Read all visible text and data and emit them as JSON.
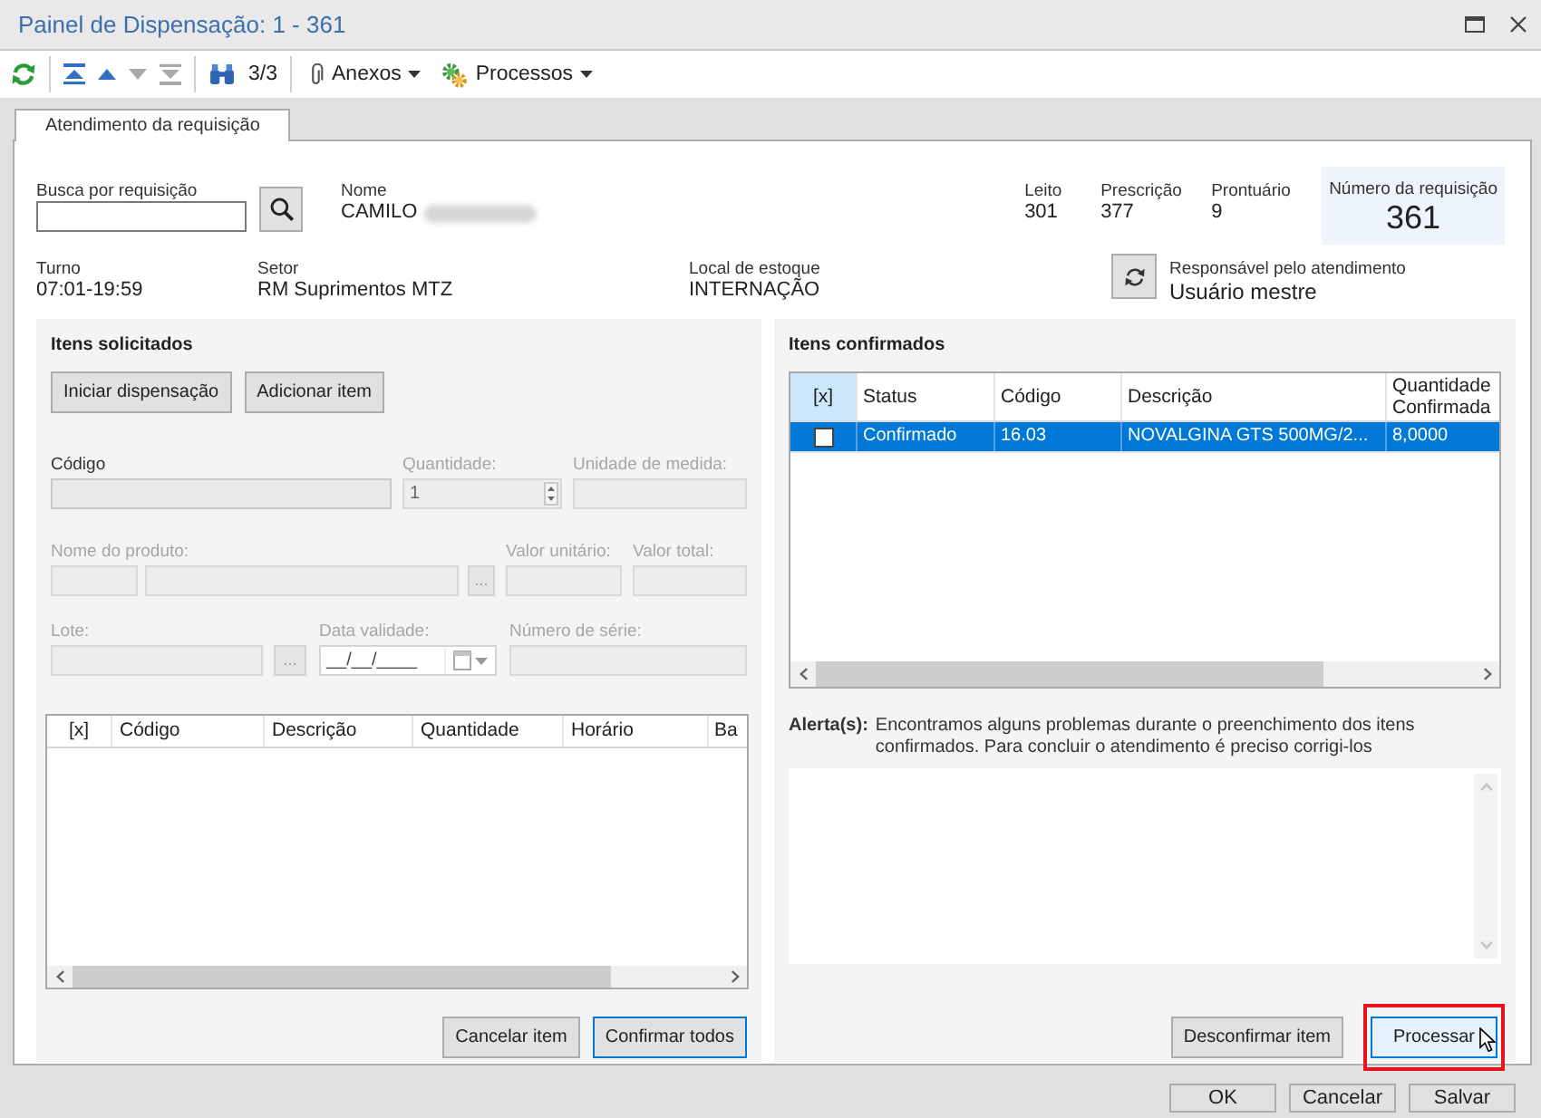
{
  "window": {
    "title": "Painel de Dispensação: 1 - 361"
  },
  "toolbar": {
    "navigation": [
      {
        "kind": "first",
        "disabled": false
      },
      {
        "kind": "previous",
        "disabled": false
      },
      {
        "kind": "next",
        "disabled": true
      },
      {
        "kind": "last",
        "disabled": true
      }
    ],
    "record_counter": "3/3",
    "menus": [
      {
        "kind": "attachments",
        "label": "Anexos"
      },
      {
        "kind": "processes",
        "label": "Processos"
      }
    ]
  },
  "tabs": [
    {
      "label": "Atendimento da requisição",
      "selected": true
    }
  ],
  "header": {
    "search": {
      "label": "Busca por requisição"
    },
    "patient": {
      "label": "Nome",
      "value": "CAMILO"
    },
    "details": [
      {
        "label": "Leito",
        "value": "301"
      },
      {
        "label": "Prescrição",
        "value": "377"
      },
      {
        "label": "Prontuário",
        "value": "9"
      }
    ],
    "requisition": {
      "label": "Número da requisição",
      "value": "361"
    },
    "info": [
      {
        "label": "Turno",
        "value": "07:01-19:59"
      },
      {
        "label": "Setor",
        "value": "RM Suprimentos MTZ"
      },
      {
        "label": "Local de estoque",
        "value": "INTERNAÇÃO"
      }
    ],
    "responsible": {
      "label": "Responsável pelo atendimento",
      "value": "Usuário mestre"
    }
  },
  "requested_items": {
    "title": "Itens solicitados",
    "actions": [
      "Iniciar dispensação",
      "Adicionar item"
    ],
    "field_rows": [
      [
        {
          "kind": "text",
          "label": "Código",
          "disabled": false
        },
        {
          "kind": "spin",
          "label": "Quantidade:",
          "value": "1",
          "disabled": true
        },
        {
          "kind": "text",
          "label": "Unidade de medida:",
          "disabled": true
        }
      ],
      [
        {
          "kind": "product",
          "label": "Nome do produto:",
          "button": "...",
          "disabled": true
        },
        {
          "kind": "text",
          "label": "Valor unitário:",
          "disabled": true
        },
        {
          "kind": "text",
          "label": "Valor total:",
          "disabled": true
        }
      ],
      [
        {
          "kind": "lookup",
          "label": "Lote:",
          "button": "...",
          "disabled": true
        },
        {
          "kind": "date",
          "label": "Data validade:",
          "value": "__/__/____",
          "disabled": true
        },
        {
          "kind": "text",
          "label": "Número de série:",
          "disabled": true
        }
      ]
    ],
    "table": {
      "columns": [
        "[x]",
        "Código",
        "Descrição",
        "Quantidade",
        "Horário",
        "Ba"
      ]
    },
    "buttons": [
      {
        "label": "Cancelar item",
        "focused": false
      },
      {
        "label": "Confirmar todos",
        "focused": true
      }
    ]
  },
  "confirmed_items": {
    "title": "Itens confirmados",
    "table": {
      "checkbox_column": "[x]",
      "columns": [
        "Status",
        "Código",
        "Descrição",
        "Quantidade Confirmada"
      ],
      "rows": [
        {
          "selected": true,
          "checked": false,
          "cells": [
            "Confirmado",
            "16.03",
            "NOVALGINA GTS 500MG/2...",
            "8,0000"
          ]
        }
      ]
    },
    "alert": {
      "label": "Alerta(s):",
      "message": "Encontramos alguns problemas durante o preenchimento dos itens confirmados. Para concluir o atendimento é preciso corrigi-los"
    },
    "buttons": [
      {
        "label": "Desconfirmar item",
        "focused": false,
        "hovered": false,
        "highlighted": false
      },
      {
        "label": "Processar",
        "focused": true,
        "hovered": true,
        "highlighted": true
      }
    ]
  },
  "dialog_buttons": [
    "OK",
    "Cancelar",
    "Salvar"
  ]
}
